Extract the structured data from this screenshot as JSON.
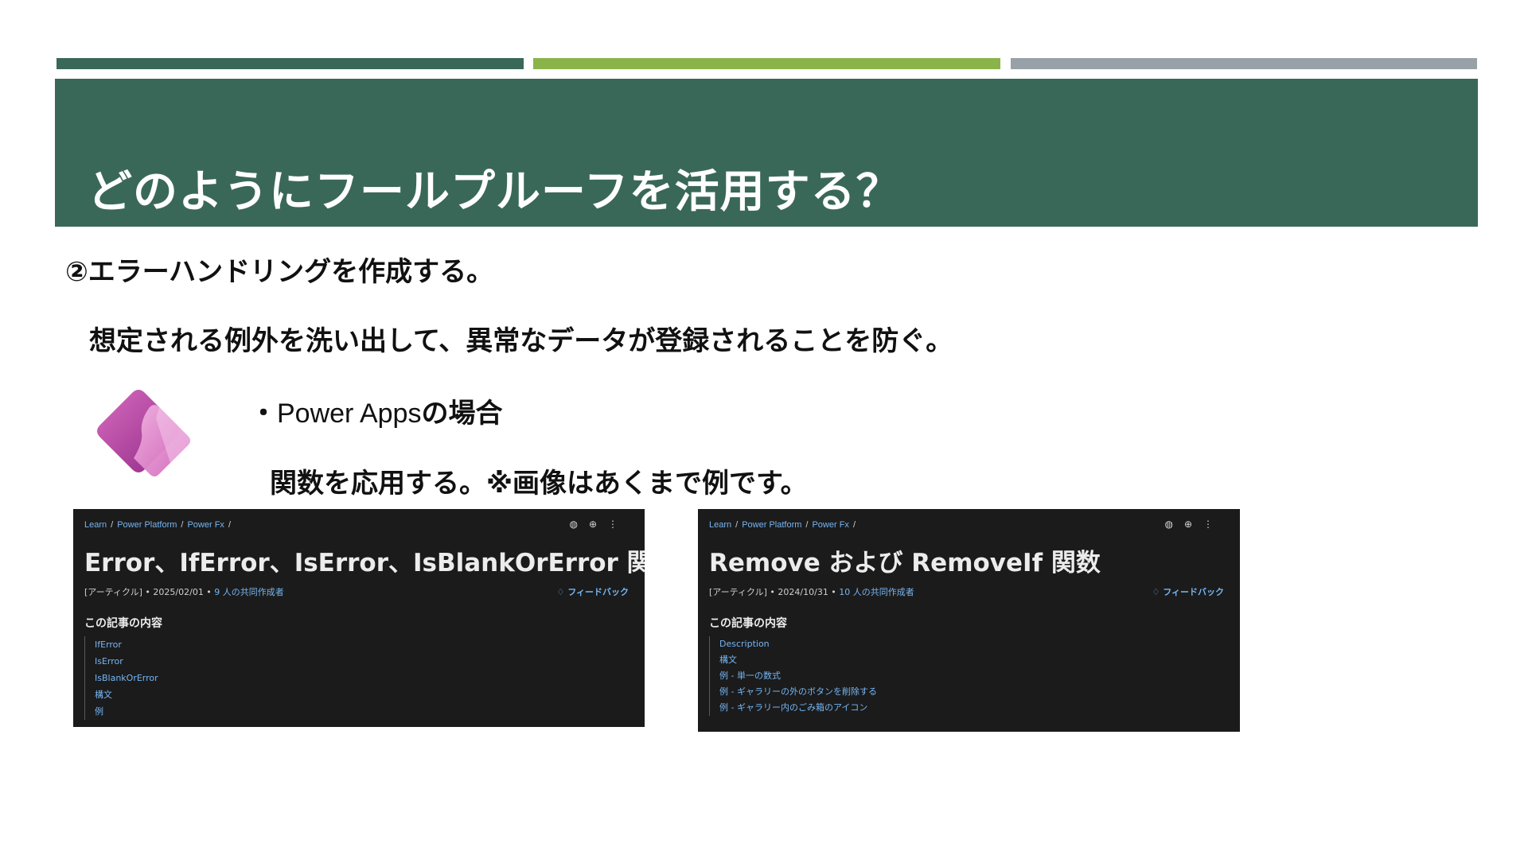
{
  "colors": {
    "accent_dark_green": "#3a6858",
    "accent_lime": "#8ab44a",
    "accent_gray": "#98a1a8",
    "logo_light": "#e8a5d8",
    "logo_mid": "#d063b8",
    "logo_dark": "#8e2a86"
  },
  "slide": {
    "title": "どのようにフールプルーフを活用する？",
    "subheading": "②エラーハンドリングを作成する。",
    "description": "想定される例外を洗い出して、異常なデータが登録されることを防ぐ。",
    "bullet_marker": "・",
    "bullet_app": "Power Apps",
    "bullet_suffix": "の場合",
    "note": "関数を応用する。※画像はあくまで例です。",
    "logo_icon": "power-apps-icon"
  },
  "screenshot_left": {
    "breadcrumb": [
      "Learn",
      "Power Platform",
      "Power Fx"
    ],
    "breadcrumb_sep": "/",
    "tool_icons": [
      "globe-icon",
      "add-circle-icon",
      "more-icon"
    ],
    "title": "Error、IfError、IsError、IsBlankOrError 関数",
    "meta_prefix": "[アーティクル] • 2025/02/01 • ",
    "meta_contributors": "9 人の共同作成者",
    "feedback": "フィードバック",
    "toc_heading": "この記事の内容",
    "toc": [
      "IfError",
      "IsError",
      "IsBlankOrError",
      "構文",
      "例"
    ]
  },
  "screenshot_right": {
    "breadcrumb": [
      "Learn",
      "Power Platform",
      "Power Fx"
    ],
    "breadcrumb_sep": "/",
    "tool_icons": [
      "globe-icon",
      "add-circle-icon",
      "more-icon"
    ],
    "title": "Remove および RemoveIf 関数",
    "meta_prefix": "[アーティクル] • 2024/10/31 • ",
    "meta_contributors": "10 人の共同作成者",
    "feedback": "フィードバック",
    "toc_heading": "この記事の内容",
    "toc": [
      "Description",
      "構文",
      "例 - 単一の数式",
      "例 - ギャラリーの外のボタンを削除する",
      "例 - ギャラリー内のごみ箱のアイコン"
    ]
  }
}
